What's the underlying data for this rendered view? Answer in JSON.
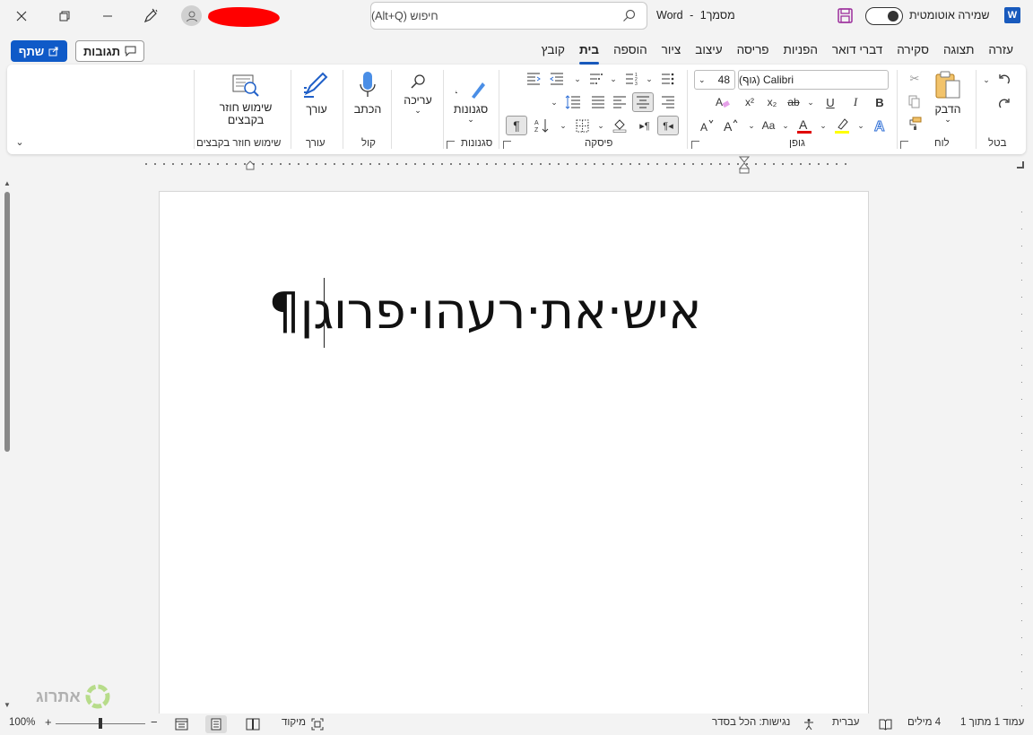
{
  "titlebar": {
    "doc_name": "מסמך1",
    "app_name": "Word",
    "separator": "-",
    "search_placeholder": "חיפוש (Alt+Q)",
    "autosave_label": "שמירה אוטומטית",
    "word_logo": "W"
  },
  "tabs": [
    "קובץ",
    "בית",
    "הוספה",
    "ציור",
    "עיצוב",
    "פריסה",
    "הפניות",
    "דברי דואר",
    "סקירה",
    "תצוגה",
    "עזרה"
  ],
  "active_tab": "בית",
  "share_label": "שתף",
  "comments_label": "תגובות",
  "ribbon": {
    "undo_group": "בטל",
    "clipboard": {
      "paste": "הדבק",
      "group": "לוח"
    },
    "font": {
      "name": "Calibri (גוף)",
      "size": "48",
      "group": "גופן",
      "bold": "B",
      "italic": "I",
      "underline": "U",
      "strike": "ab",
      "sub": "x₂",
      "sup": "x²",
      "color_a": "A",
      "case": "Aa"
    },
    "paragraph": {
      "group": "פיסקה"
    },
    "styles": {
      "label": "סגנונות",
      "group": "סגנונות"
    },
    "editing": {
      "label": "עריכה"
    },
    "voice": {
      "label": "הכתב",
      "group": "קול"
    },
    "editor": {
      "label": "עורך",
      "group": "עורך"
    },
    "reuse": {
      "label": "שימוש חוזר בקבצים",
      "group": "שימוש חוזר בקבצים"
    }
  },
  "document": {
    "text": "איש·את·רעהו·פרוגן¶"
  },
  "statusbar": {
    "page": "עמוד 1 מתוך 1",
    "words": "4 מילים",
    "language": "עברית",
    "accessibility": "נגישות: הכל בסדר",
    "focus": "מיקוד",
    "zoom": "100%",
    "minus": "−",
    "plus": "+"
  },
  "watermark": "אתרוג",
  "colors": {
    "accent": "#185abd",
    "share": "#0f5ac8",
    "redaction": "#ff0000",
    "font_color": "#e00000",
    "highlight": "#ffff00"
  },
  "icons": [
    "close-icon",
    "restore-icon",
    "minimize-icon",
    "pen-icon",
    "user-icon",
    "search-icon",
    "save-icon",
    "undo-icon",
    "redo-icon",
    "paste-icon",
    "mic-icon",
    "editor-icon",
    "styles-icon",
    "find-icon",
    "reuse-files-icon"
  ]
}
